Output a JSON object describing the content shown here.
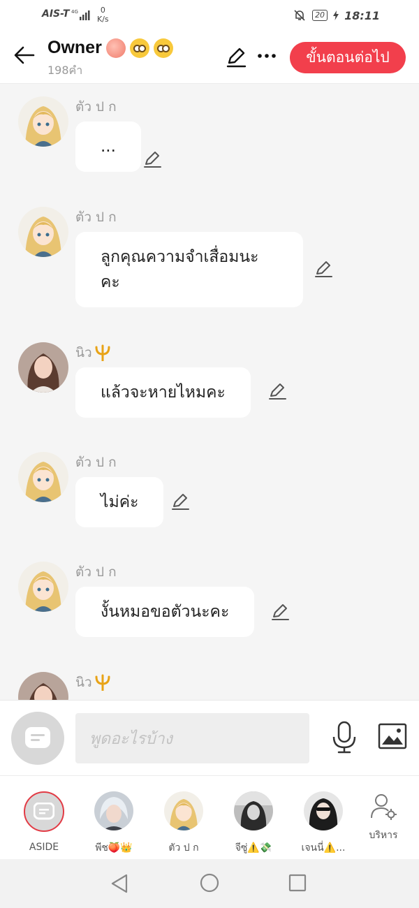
{
  "status_bar": {
    "carrier": "AIS-T",
    "network": "4G",
    "speed_value": "0",
    "speed_unit": "K/s",
    "battery": "20",
    "time": "18:11"
  },
  "header": {
    "title": "Owner",
    "title_emojis": [
      "peach",
      "flushed-face",
      "kissing-face"
    ],
    "subtitle": "198คำ",
    "next_button": "ขั้นตอนต่อไป"
  },
  "messages": [
    {
      "sender": "ตัว ป ก",
      "text": "...",
      "avatar": "anime-blonde"
    },
    {
      "sender": "ตัว ป ก",
      "text": "ลูกคุณความจำเสื่อมนะคะ",
      "avatar": "anime-blonde"
    },
    {
      "sender": "นิว",
      "sender_badge": "trident",
      "text": "แล้วจะหายไหมคะ",
      "avatar": "woman-photo"
    },
    {
      "sender": "ตัว ป ก",
      "text": "ไม่ค่ะ",
      "avatar": "anime-blonde"
    },
    {
      "sender": "ตัว ป ก",
      "text": "งั้นหมอขอตัวนะคะ",
      "avatar": "anime-blonde"
    },
    {
      "sender": "นิว",
      "sender_badge": "trident",
      "text": "",
      "avatar": "woman-photo"
    }
  ],
  "input": {
    "placeholder": "พูดอะไรบ้าง"
  },
  "personas": [
    {
      "label": "ASIDE"
    },
    {
      "label": "พีช🍑👑"
    },
    {
      "label": "ตัว ป ก"
    },
    {
      "label": "จีซู่⚠️💸"
    },
    {
      "label": "เจนนี่⚠️..."
    },
    {
      "label": "บริหาร"
    }
  ],
  "colors": {
    "accent": "#f23f4c",
    "background": "#f5f5f5",
    "bubble": "#ffffff"
  }
}
